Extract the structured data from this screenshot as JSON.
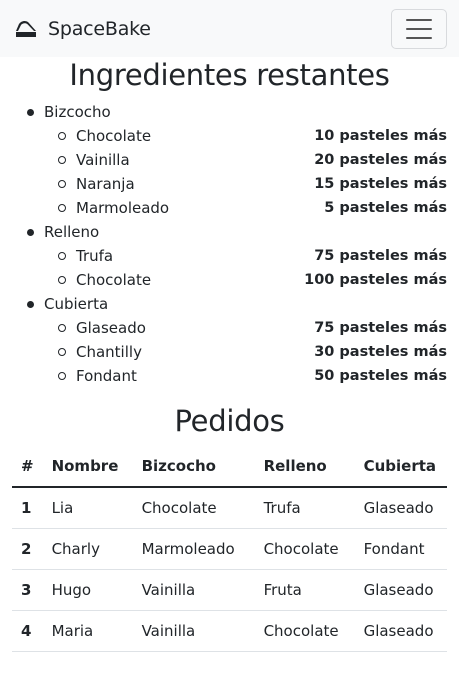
{
  "navbar": {
    "brand": "SpaceBake"
  },
  "ingredients": {
    "title": "Ingredientes restantes",
    "categories": [
      {
        "name": "Bizcocho",
        "items": [
          {
            "name": "Chocolate",
            "qty": "10 pasteles más"
          },
          {
            "name": "Vainilla",
            "qty": "20 pasteles más"
          },
          {
            "name": "Naranja",
            "qty": "15 pasteles más"
          },
          {
            "name": "Marmoleado",
            "qty": "5 pasteles más"
          }
        ]
      },
      {
        "name": "Relleno",
        "items": [
          {
            "name": "Trufa",
            "qty": "75 pasteles más"
          },
          {
            "name": "Chocolate",
            "qty": "100 pasteles más"
          }
        ]
      },
      {
        "name": "Cubierta",
        "items": [
          {
            "name": "Glaseado",
            "qty": "75 pasteles más"
          },
          {
            "name": "Chantilly",
            "qty": "30 pasteles más"
          },
          {
            "name": "Fondant",
            "qty": "50 pasteles más"
          }
        ]
      }
    ]
  },
  "orders": {
    "title": "Pedidos",
    "headers": [
      "#",
      "Nombre",
      "Bizcocho",
      "Relleno",
      "Cubierta"
    ],
    "rows": [
      [
        "1",
        "Lia",
        "Chocolate",
        "Trufa",
        "Glaseado"
      ],
      [
        "2",
        "Charly",
        "Marmoleado",
        "Chocolate",
        "Fondant"
      ],
      [
        "3",
        "Hugo",
        "Vainilla",
        "Fruta",
        "Glaseado"
      ],
      [
        "4",
        "Maria",
        "Vainilla",
        "Chocolate",
        "Glaseado"
      ]
    ]
  }
}
